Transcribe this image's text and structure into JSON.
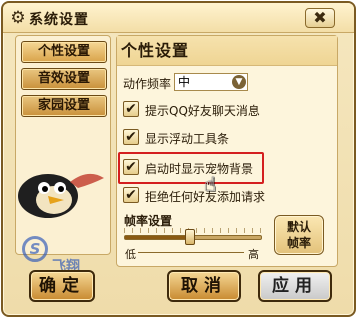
{
  "window": {
    "title": "系统设置",
    "close_label": "✖",
    "icons": {
      "title": "gear-icon",
      "close": "close-icon"
    }
  },
  "sidebar": {
    "items": [
      {
        "label": "个性设置",
        "active": true
      },
      {
        "label": "音效设置",
        "active": false
      },
      {
        "label": "家园设置",
        "active": false
      }
    ]
  },
  "panel": {
    "title": "个性设置",
    "frame_rate_label": "动作频率",
    "frame_rate_value": "中",
    "options": [
      {
        "label": "提示QQ好友聊天消息",
        "checked": true
      },
      {
        "label": "显示浮动工具条",
        "checked": true
      },
      {
        "label": "启动时显示宠物背景",
        "checked": true
      },
      {
        "label": "拒绝任何好友添加请求",
        "checked": true
      }
    ],
    "check_mark": "✔"
  },
  "slider": {
    "title": "帧率设置",
    "low_label": "低",
    "high_label": "高",
    "level": 0.48
  },
  "default_button": {
    "line1": "默认",
    "line2": "帧率"
  },
  "buttons": {
    "ok": "确定",
    "cancel": "取消",
    "apply": "应用"
  },
  "colors": {
    "highlight": "#d41f1f",
    "window_bg": "#f5e7bf",
    "button_gold": "#d9a34a"
  },
  "watermark": {
    "text": "飞翔"
  }
}
